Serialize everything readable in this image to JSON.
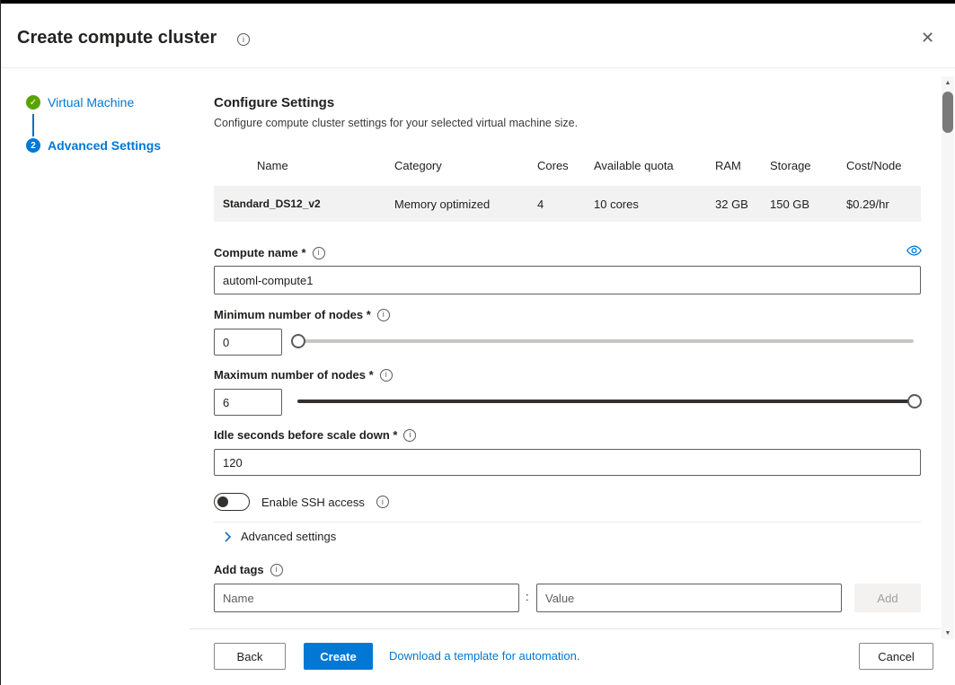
{
  "window": {
    "title": "Create compute cluster",
    "close_icon": "✕"
  },
  "stepper": {
    "steps": [
      {
        "label": "Virtual Machine",
        "state": "complete",
        "icon": "✓"
      },
      {
        "label": "Advanced Settings",
        "state": "current",
        "number": "2"
      }
    ]
  },
  "main": {
    "heading": "Configure Settings",
    "subheading": "Configure compute cluster settings for your selected virtual machine size.",
    "vm_table": {
      "headers": [
        "Name",
        "Category",
        "Cores",
        "Available quota",
        "RAM",
        "Storage",
        "Cost/Node"
      ],
      "selected_row": [
        "Standard_DS12_v2",
        "Memory optimized",
        "4",
        "10 cores",
        "32 GB",
        "150 GB",
        "$0.29/hr"
      ]
    },
    "compute_name": {
      "label": "Compute name *",
      "value": "automl-compute1"
    },
    "min_nodes": {
      "label": "Minimum number of nodes *",
      "value": "0"
    },
    "max_nodes": {
      "label": "Maximum number of nodes *",
      "value": "6"
    },
    "idle_seconds": {
      "label": "Idle seconds before scale down *",
      "value": "120"
    },
    "ssh": {
      "label": "Enable SSH access",
      "state": "off"
    },
    "advanced": {
      "label": "Advanced settings"
    },
    "tags": {
      "label": "Add tags",
      "name_placeholder": "Name",
      "separator": ":",
      "value_placeholder": "Value",
      "add_label": "Add"
    }
  },
  "footer": {
    "back_label": "Back",
    "create_label": "Create",
    "automation_link": "Download a template for automation.",
    "cancel_label": "Cancel"
  },
  "icons": {
    "info": "i",
    "scroll_up": "▲",
    "scroll_down": "▼"
  },
  "colors": {
    "accent": "#0078d4",
    "success_green": "#57a300",
    "selected_row_bg": "#f2f2f2"
  }
}
